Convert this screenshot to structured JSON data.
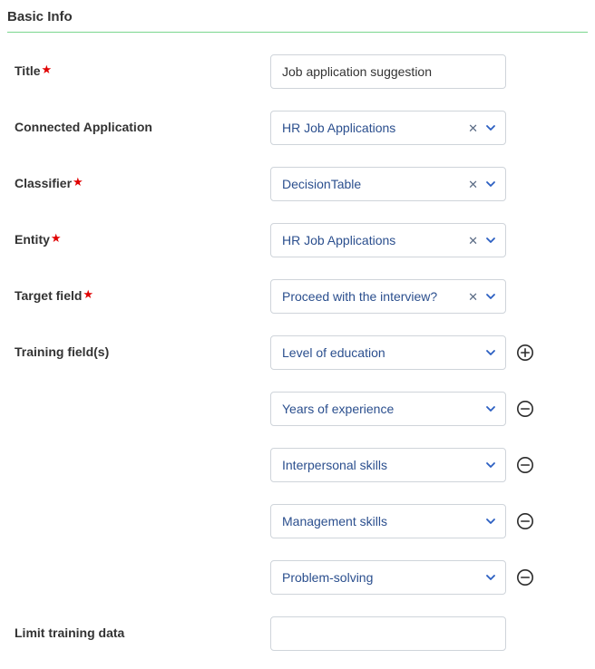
{
  "section": {
    "title": "Basic Info"
  },
  "labels": {
    "title": "Title",
    "connected_application": "Connected Application",
    "classifier": "Classifier",
    "entity": "Entity",
    "target_field": "Target field",
    "training_fields": "Training field(s)",
    "limit_training_data": "Limit training data"
  },
  "fields": {
    "title": {
      "value": "Job application suggestion",
      "required": true
    },
    "connected_application": {
      "value": "HR Job Applications",
      "clearable": true
    },
    "classifier": {
      "value": "DecisionTable",
      "required": true,
      "clearable": true
    },
    "entity": {
      "value": "HR Job Applications",
      "required": true,
      "clearable": true
    },
    "target_field": {
      "value": "Proceed with the interview?",
      "required": true,
      "clearable": true
    },
    "training_fields": [
      {
        "value": "Level of education",
        "action": "add"
      },
      {
        "value": "Years of experience",
        "action": "remove"
      },
      {
        "value": "Interpersonal skills",
        "action": "remove"
      },
      {
        "value": "Management skills",
        "action": "remove"
      },
      {
        "value": "Problem-solving",
        "action": "remove"
      }
    ],
    "limit_training_data": {
      "value": ""
    }
  }
}
